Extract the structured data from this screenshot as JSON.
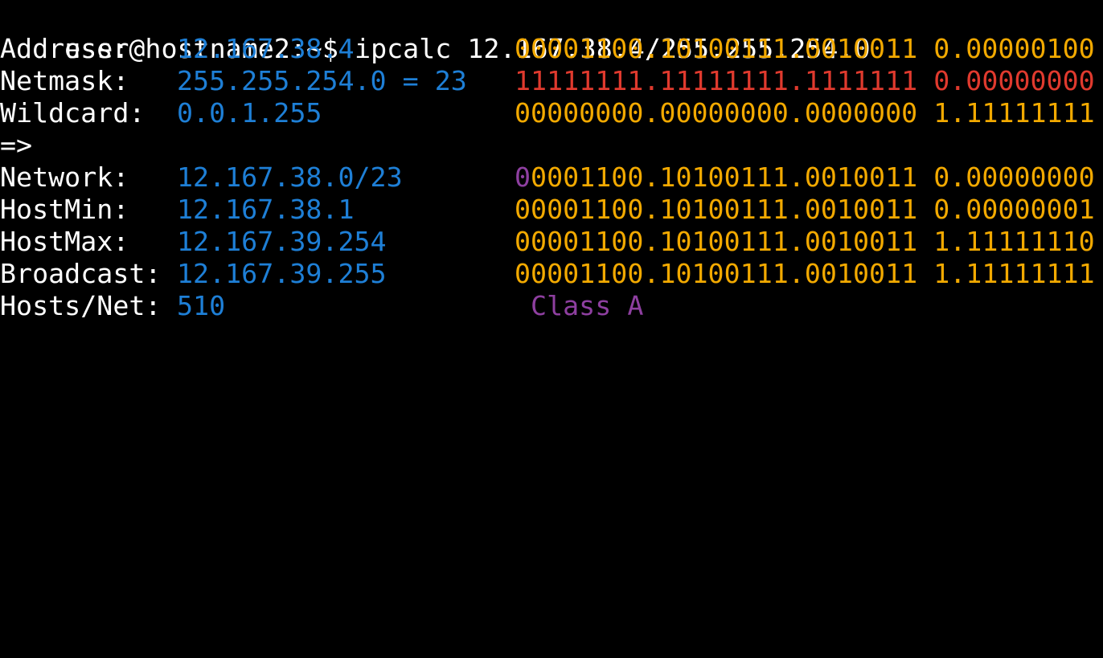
{
  "colors": {
    "background": "#000000",
    "label": "#ffffff",
    "value": "#1e7fd6",
    "binary": "#f2a900",
    "netmask_binary": "#e03a2e",
    "class_bits": "#8e3fa0"
  },
  "prompt": {
    "text": "user@hostname2:~$ ipcalc 12.167.38.4/255.255.254.0"
  },
  "rows": {
    "address": {
      "label": "Address:",
      "value": "12.167.38.4",
      "binary": "00001100.10100111.0010011 0.00000100"
    },
    "netmask": {
      "label": "Netmask:",
      "value": "255.255.254.0 = 23",
      "binary": "11111111.11111111.1111111 0.00000000"
    },
    "wildcard": {
      "label": "Wildcard:",
      "value": "0.0.1.255",
      "binary": "00000000.00000000.0000000 1.11111111"
    },
    "arrow": {
      "label": "=>"
    },
    "network": {
      "label": "Network:",
      "value": "12.167.38.0/23",
      "binary_class_bit": "0",
      "binary_rest": "0001100.10100111.0010011 0.00000000"
    },
    "hostmin": {
      "label": "HostMin:",
      "value": "12.167.38.1",
      "binary": "00001100.10100111.0010011 0.00000001"
    },
    "hostmax": {
      "label": "HostMax:",
      "value": "12.167.39.254",
      "binary": "00001100.10100111.0010011 1.11111110"
    },
    "broadcast": {
      "label": "Broadcast:",
      "value": "12.167.39.255",
      "binary": "00001100.10100111.0010011 1.11111111"
    },
    "hosts": {
      "label": "Hosts/Net:",
      "value": "510",
      "class_label": "Class A"
    }
  }
}
